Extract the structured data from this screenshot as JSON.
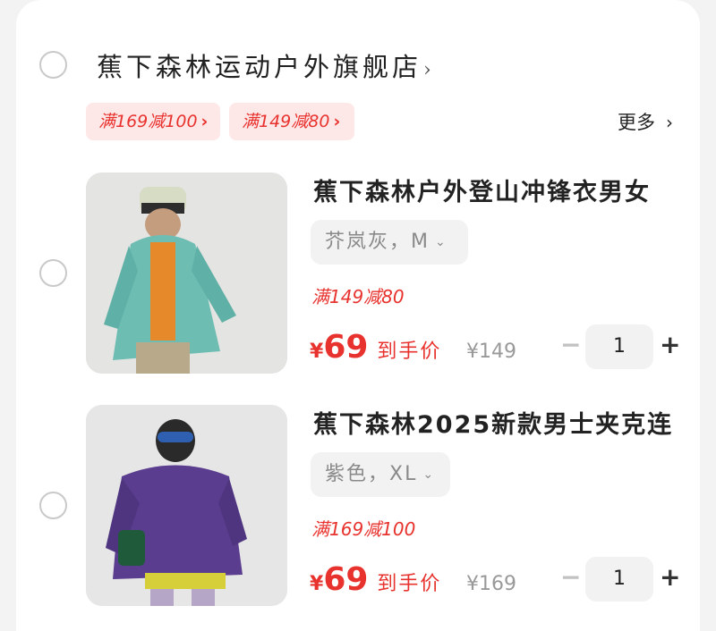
{
  "shop": {
    "name": "蕉下森林运动户外旗舰店",
    "chevron": "›",
    "coupons": [
      {
        "label": "满169减100",
        "arrow": "›"
      },
      {
        "label": "满149减80",
        "arrow": "›"
      }
    ],
    "more_label": "更多",
    "more_arrow": "›"
  },
  "items": [
    {
      "title": "蕉下森林户外登山冲锋衣男女",
      "spec": "芥岚灰，M",
      "spec_dropdown": "⌄",
      "promo": "满149减80",
      "price_symbol": "¥",
      "price": "69",
      "price_label": "到手价",
      "original_price": "¥149",
      "minus": "−",
      "quantity": "1",
      "plus": "+",
      "image_color": "#6dbdb3"
    },
    {
      "title": "蕉下森林2025新款男士夹克连",
      "spec": "紫色，XL",
      "spec_dropdown": "⌄",
      "promo": "满169减100",
      "price_symbol": "¥",
      "price": "69",
      "price_label": "到手价",
      "original_price": "¥169",
      "minus": "−",
      "quantity": "1",
      "plus": "+",
      "image_color": "#5a3d8f"
    }
  ],
  "colors": {
    "accent_red": "#e8322e",
    "coupon_bg": "#fde7e7"
  }
}
